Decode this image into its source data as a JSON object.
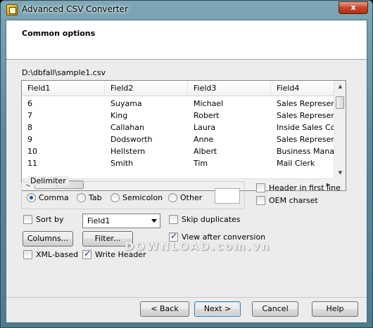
{
  "window": {
    "title": "Advanced CSV Converter",
    "close_label": "x"
  },
  "page": {
    "title": "Common options",
    "file_path": "D:\\dbfall\\sample1.csv"
  },
  "table": {
    "columns": [
      "Field1",
      "Field2",
      "Field3",
      "Field4"
    ],
    "rows": [
      [
        "6",
        "Suyama",
        "Michael",
        "Sales Representa"
      ],
      [
        "7",
        "King",
        "Robert",
        "Sales Representa"
      ],
      [
        "8",
        "Callahan",
        "Laura",
        "Inside Sales Coor"
      ],
      [
        "9",
        "Dodsworth",
        "Anne",
        "Sales Representa"
      ],
      [
        "10",
        "Hellstern",
        "Albert",
        "Business Manage"
      ],
      [
        "11",
        "Smith",
        "Tim",
        "Mail Clerk"
      ]
    ]
  },
  "delimiter": {
    "label": "Delimiter",
    "options": [
      "Comma",
      "Tab",
      "Semicolon",
      "Other"
    ],
    "selected": "Comma",
    "other_value": ""
  },
  "options": {
    "header_first_line": {
      "label": "Header in first line",
      "checked": false
    },
    "oem_charset": {
      "label": "OEM charset",
      "checked": false
    },
    "sort_by": {
      "label": "Sort by",
      "checked": false,
      "value": "Field1"
    },
    "skip_duplicates": {
      "label": "Skip duplicates",
      "checked": false
    },
    "view_after_conversion": {
      "label": "View after conversion",
      "checked": true
    },
    "xml_based": {
      "label": "XML-based",
      "checked": false
    },
    "write_header": {
      "label": "Write Header",
      "checked": true
    }
  },
  "buttons": {
    "columns": "Columns...",
    "filter": "Filter...",
    "back": "Back",
    "next": "Next >",
    "cancel": "Cancel",
    "help": "Help"
  },
  "watermark": "DOWNLOAD.com.vn"
}
